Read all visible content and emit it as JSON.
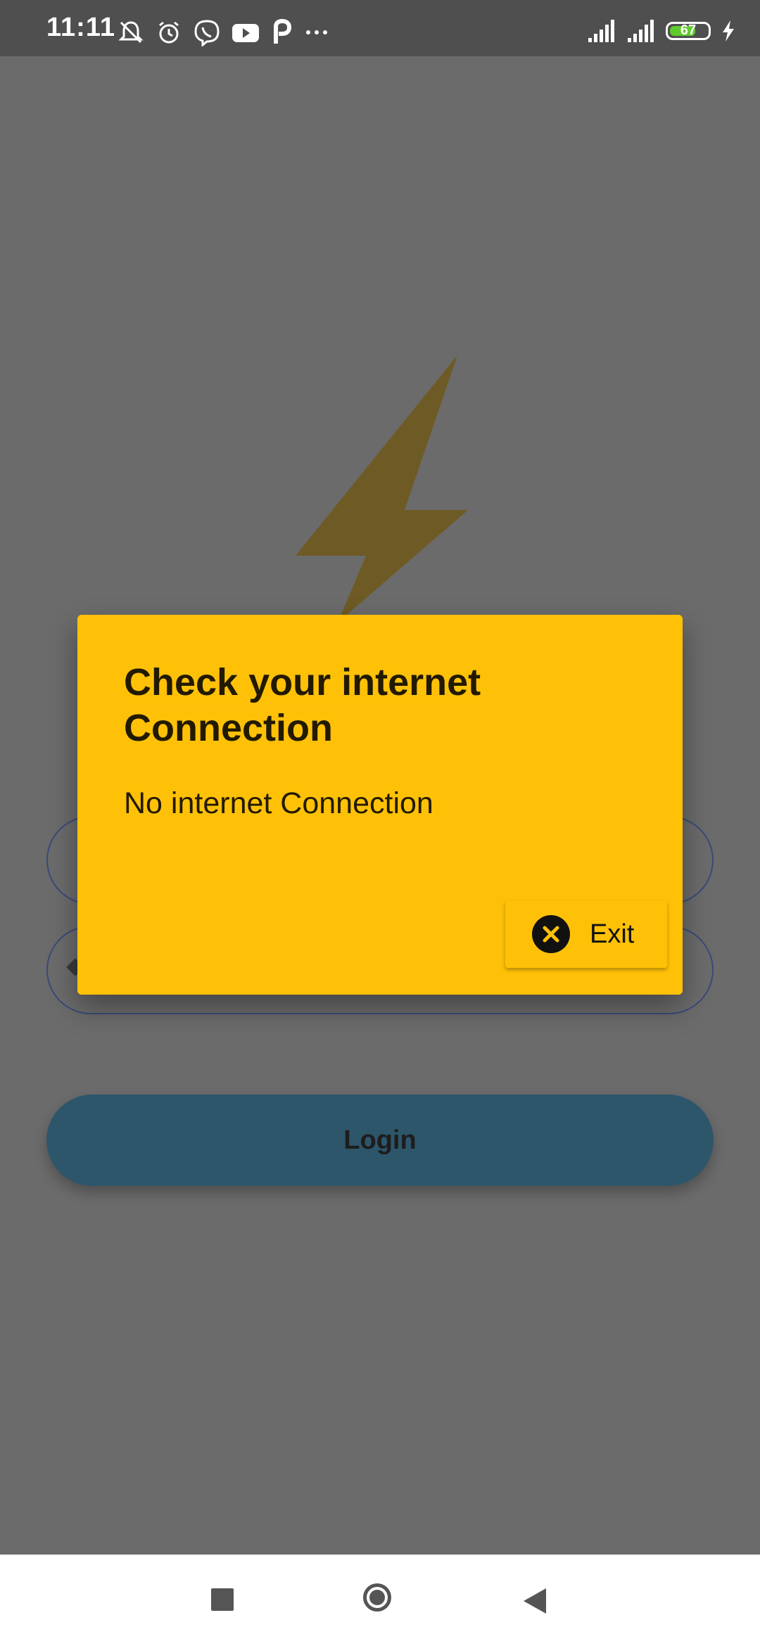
{
  "status_bar": {
    "time": "11:11",
    "battery_level": "67",
    "icons_left": [
      "mute-icon",
      "alarm-icon",
      "viber-icon",
      "youtube-icon",
      "parking-icon",
      "more-icon"
    ],
    "icons_right": [
      "signal-icon",
      "signal-icon",
      "battery-icon",
      "charging-icon"
    ]
  },
  "background": {
    "login_label": "Login"
  },
  "dialog": {
    "title": "Check your internet Connection",
    "message": "No internet Connection",
    "exit_label": "Exit",
    "accent_color": "#ffc107"
  },
  "nav_bar": {
    "buttons": [
      "recents",
      "home",
      "back"
    ]
  }
}
